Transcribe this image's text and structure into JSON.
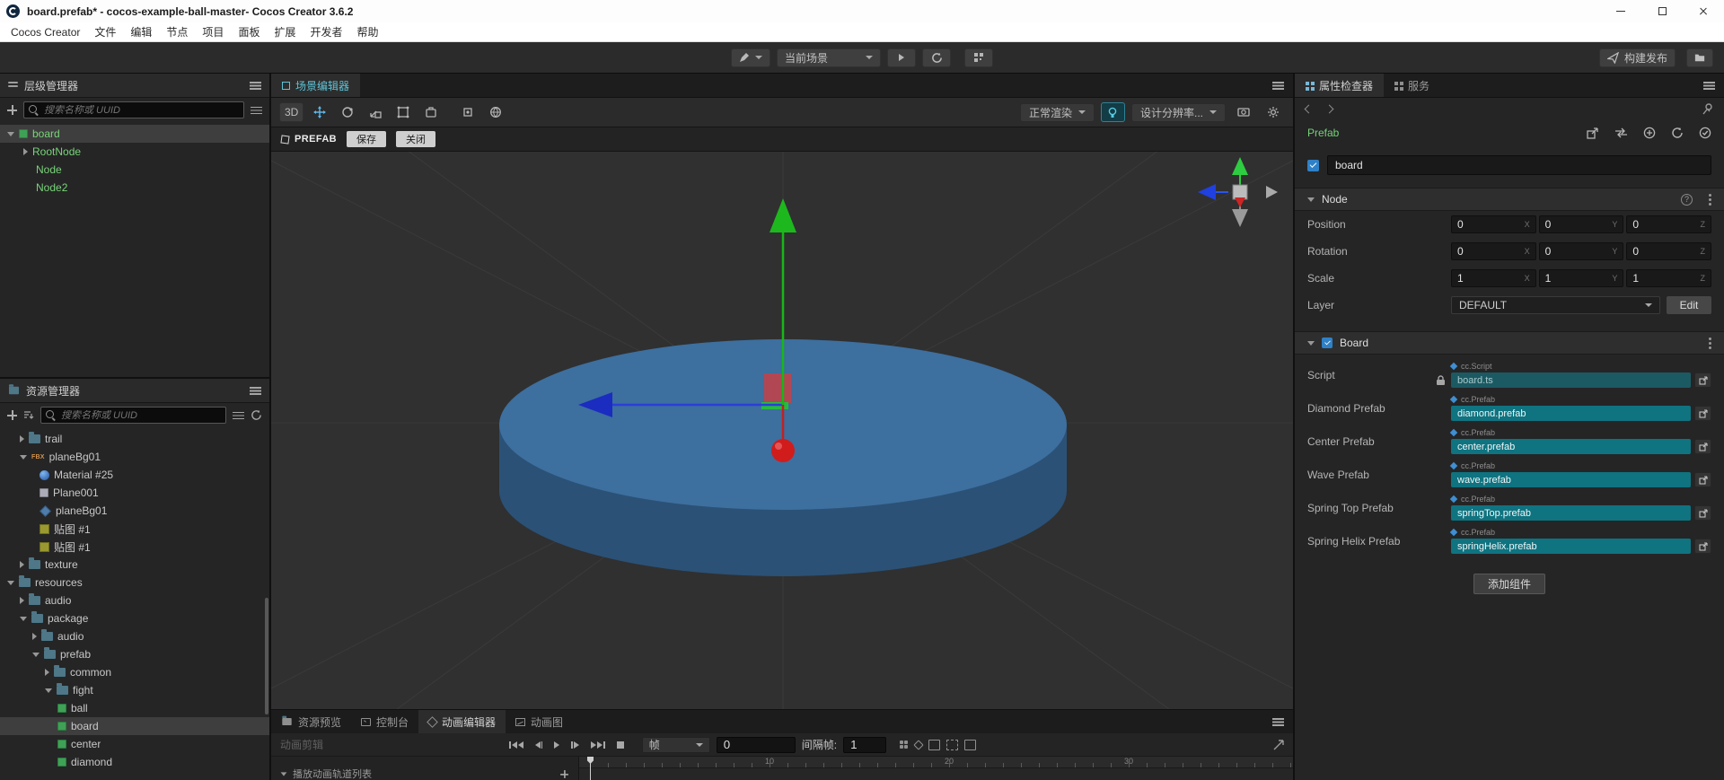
{
  "window": {
    "title": "board.prefab* - cocos-example-ball-master- Cocos Creator 3.6.2",
    "menus": [
      "Cocos Creator",
      "文件",
      "编辑",
      "节点",
      "项目",
      "面板",
      "扩展",
      "开发者",
      "帮助"
    ]
  },
  "toolbar": {
    "scene_dropdown": "当前场景",
    "build": "构建发布"
  },
  "hierarchy": {
    "title": "层级管理器",
    "search_placeholder": "搜索名称或 UUID",
    "nodes": [
      {
        "label": "board"
      },
      {
        "label": "RootNode"
      },
      {
        "label": "Node"
      },
      {
        "label": "Node2"
      }
    ]
  },
  "assets": {
    "title": "资源管理器",
    "search_placeholder": "搜索名称或 UUID",
    "items": [
      {
        "label": "trail"
      },
      {
        "label": "planeBg01",
        "badge": "FBX"
      },
      {
        "label": "Material #25"
      },
      {
        "label": "Plane001"
      },
      {
        "label": "planeBg01"
      },
      {
        "label": "贴图 #1"
      },
      {
        "label": "贴图 #1"
      },
      {
        "label": "texture"
      },
      {
        "label": "resources"
      },
      {
        "label": "audio"
      },
      {
        "label": "package"
      },
      {
        "label": "audio"
      },
      {
        "label": "prefab"
      },
      {
        "label": "common"
      },
      {
        "label": "fight"
      },
      {
        "label": "ball"
      },
      {
        "label": "board"
      },
      {
        "label": "center"
      },
      {
        "label": "diamond"
      }
    ]
  },
  "scene": {
    "tab": "场景编辑器",
    "mode": "3D",
    "render_mode": "正常渲染",
    "resolution": "设计分辨率...",
    "prefab_label": "PREFAB",
    "save": "保存",
    "close": "关闭"
  },
  "timeline": {
    "tabs": [
      "资源预览",
      "控制台",
      "动画编辑器",
      "动画图"
    ],
    "clip_label": "动画剪辑",
    "frame_unit": "帧",
    "current_frame": "0",
    "interval_label": "间隔帧:",
    "interval_value": "1",
    "ruler_labels": [
      "10",
      "20",
      "30"
    ],
    "track_list_label": "播放动画轨道列表"
  },
  "inspector": {
    "tab_inspector": "属性检查器",
    "tab_service": "服务",
    "prefab_badge": "Prefab",
    "node_name": "board",
    "node_section": "Node",
    "axis_labels": [
      "X",
      "Y",
      "Z"
    ],
    "rows": {
      "position": {
        "label": "Position",
        "x": "0",
        "y": "0",
        "z": "0"
      },
      "rotation": {
        "label": "Rotation",
        "x": "0",
        "y": "0",
        "z": "0"
      },
      "scale": {
        "label": "Scale",
        "x": "1",
        "y": "1",
        "z": "1"
      },
      "layer": {
        "label": "Layer",
        "value": "DEFAULT",
        "edit": "Edit"
      }
    },
    "board_section": "Board",
    "fields": [
      {
        "label": "Script",
        "type": "cc.Script",
        "value": "board.ts"
      },
      {
        "label": "Diamond Prefab",
        "type": "cc.Prefab",
        "value": "diamond.prefab"
      },
      {
        "label": "Center Prefab",
        "type": "cc.Prefab",
        "value": "center.prefab"
      },
      {
        "label": "Wave Prefab",
        "type": "cc.Prefab",
        "value": "wave.prefab"
      },
      {
        "label": "Spring Top Prefab",
        "type": "cc.Prefab",
        "value": "springTop.prefab"
      },
      {
        "label": "Spring Helix Prefab",
        "type": "cc.Prefab",
        "value": "springHelix.prefab"
      }
    ],
    "add_component": "添加组件"
  }
}
